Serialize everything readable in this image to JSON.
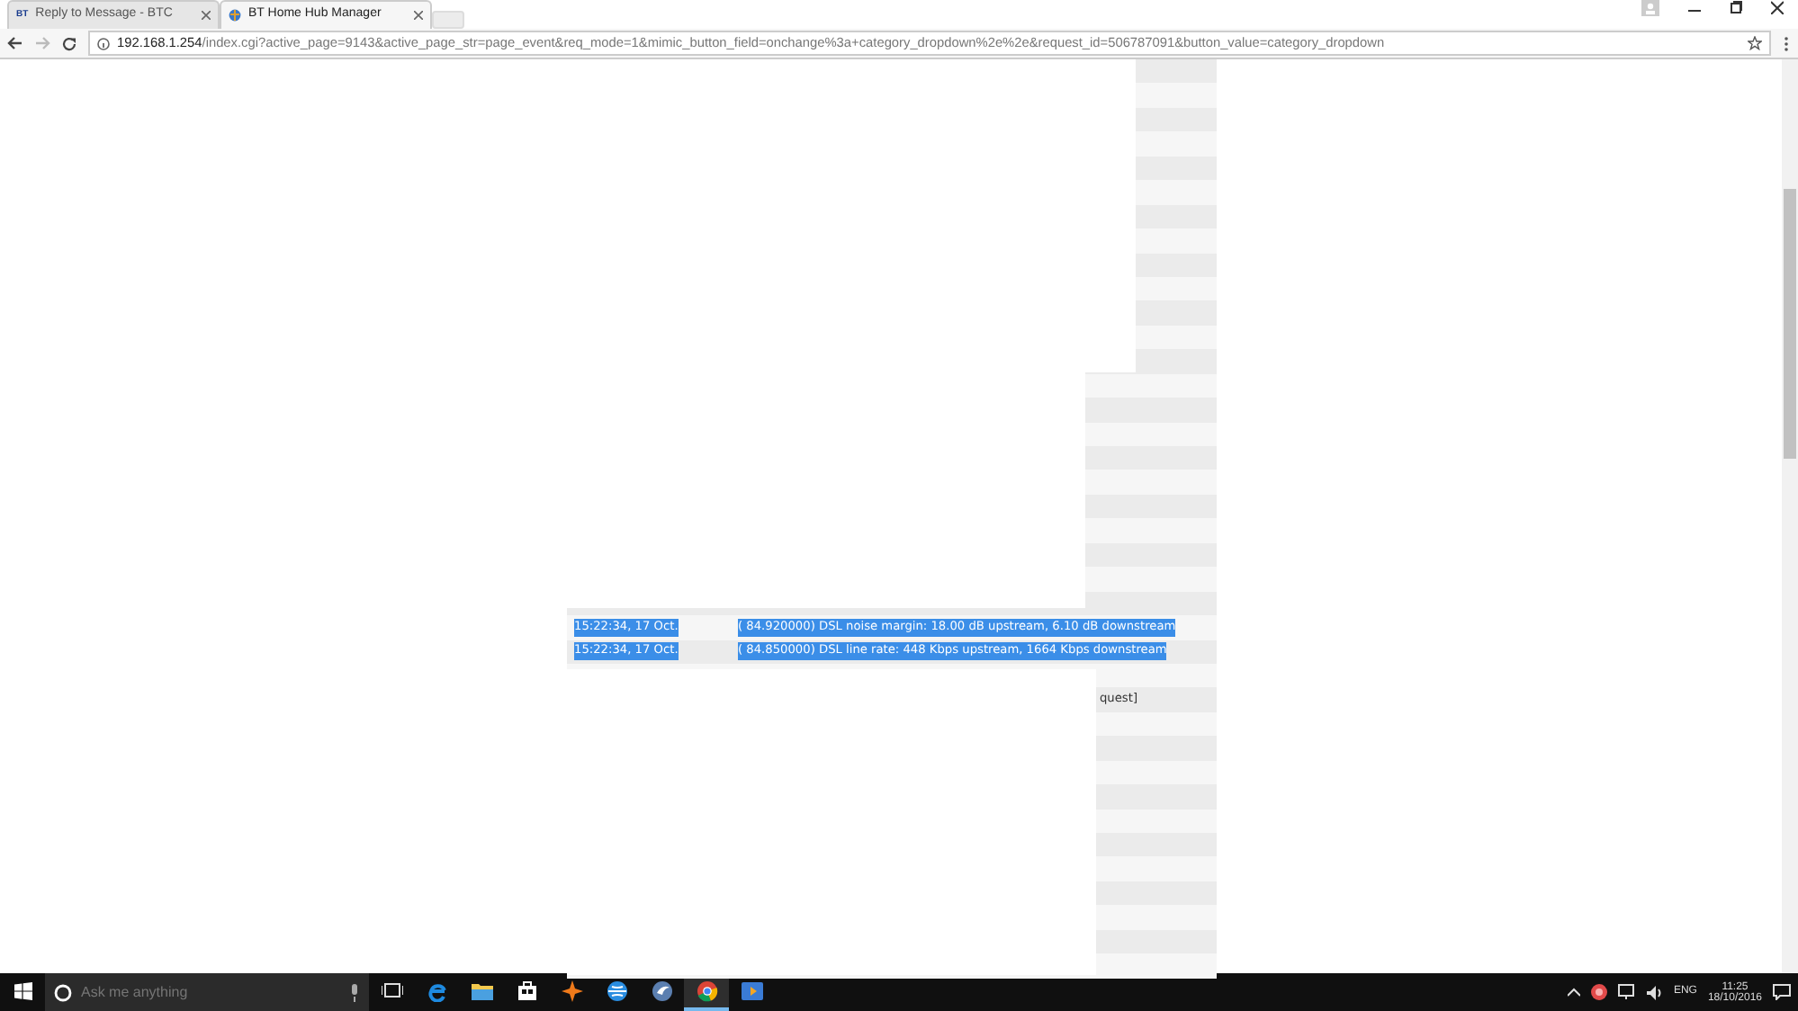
{
  "browser": {
    "tabs": [
      {
        "badge": "BT",
        "title": "Reply to Message - BTC",
        "selected": false
      },
      {
        "title": "BT Home Hub Manager",
        "selected": true
      }
    ],
    "address": {
      "host": "192.168.1.254",
      "path": "/index.cgi?active_page=9143&active_page_str=page_event&req_mode=1&mimic_button_field=onchange%3a+category_dropdown%2e%2e&request_id=506787091&button_value=category_dropdown"
    }
  },
  "event_log": {
    "rows": [
      {
        "time": "15:22:34, 17 Oct.",
        "message": "( 84.920000) DSL noise margin: 18.00 dB upstream, 6.10 dB downstream",
        "selected": true
      },
      {
        "time": "15:22:34, 17 Oct.",
        "message": "( 84.850000) DSL line rate: 448 Kbps upstream, 1664 Kbps downstream",
        "selected": true
      },
      {
        "message": "quest]",
        "selected": false
      }
    ]
  },
  "taskbar": {
    "search": {
      "placeholder": "Ask me anything"
    },
    "apps": [
      {
        "kind": "task-view",
        "selected": false
      },
      {
        "kind": "edge",
        "selected": false
      },
      {
        "kind": "folder",
        "selected": false
      },
      {
        "kind": "store",
        "selected": false
      },
      {
        "kind": "shield",
        "selected": false
      },
      {
        "kind": "globe",
        "selected": false
      },
      {
        "kind": "mail",
        "selected": false
      },
      {
        "kind": "chrome",
        "selected": true
      },
      {
        "kind": "media",
        "selected": false
      }
    ],
    "language": "ENG",
    "time": "11:25",
    "date": "18/10/2016"
  }
}
